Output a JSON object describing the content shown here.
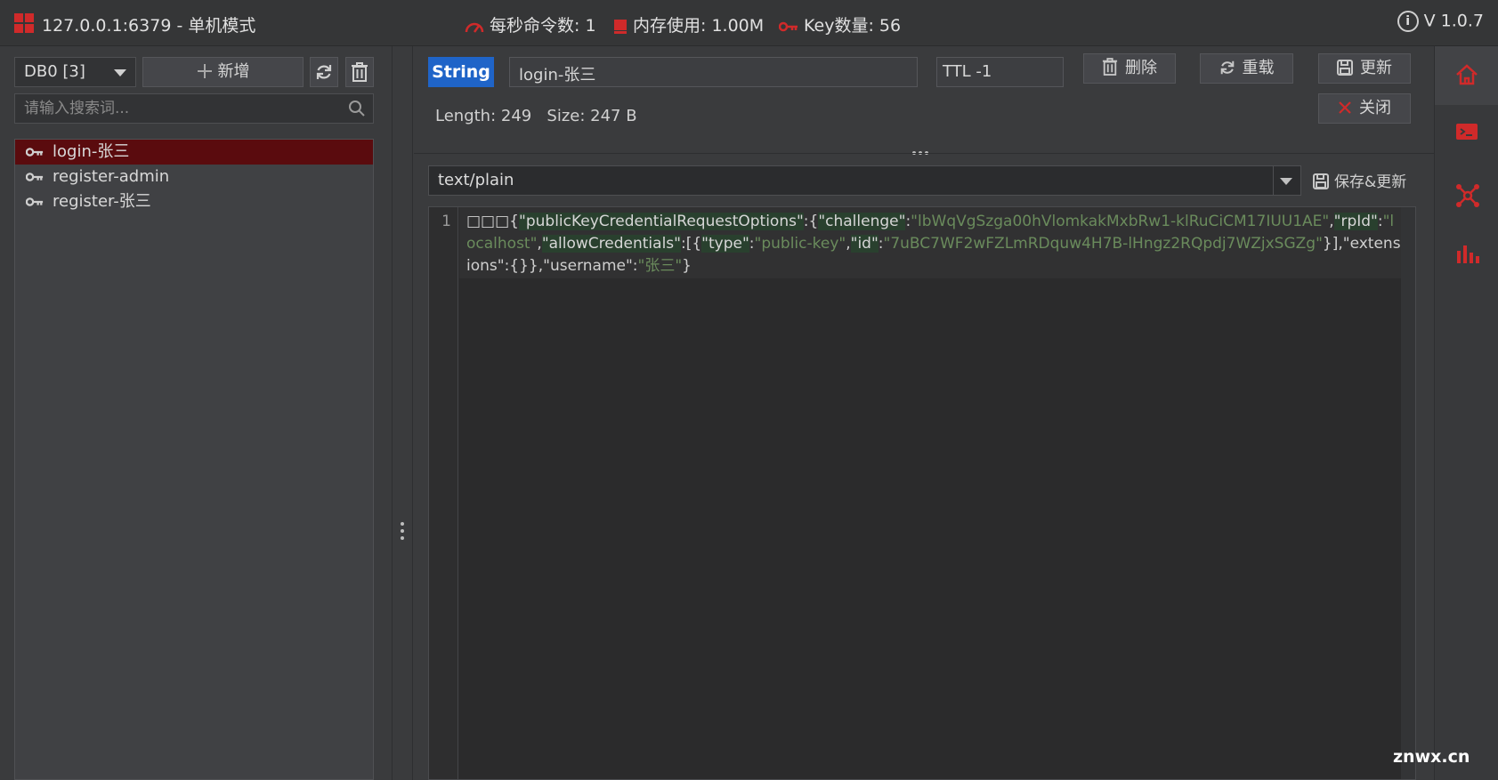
{
  "topbar": {
    "title": "127.0.0.1:6379 - 单机模式",
    "stats": {
      "ops_label": "每秒命令数: 1",
      "memory_label": "内存使用: 1.00M",
      "keys_label": "Key数量: 56"
    },
    "version": "V 1.0.7"
  },
  "left": {
    "db_select": "DB0 [3]",
    "add_label": "新增",
    "search_placeholder": "请输入搜索词...",
    "keys": [
      {
        "label": "login-张三",
        "active": true
      },
      {
        "label": "register-admin",
        "active": false
      },
      {
        "label": "register-张三",
        "active": false
      }
    ]
  },
  "main": {
    "type_badge": "String",
    "key_name": "login-张三",
    "ttl": "TTL -1",
    "actions": {
      "delete": "删除",
      "reload": "重载",
      "update": "更新",
      "close": "关闭"
    },
    "meta": "Length: 249   Size: 247 B",
    "format": "text/plain",
    "save_update": "保存&更新",
    "editor": {
      "line_number": "1",
      "prefix": "□□□{",
      "tokens": [
        {
          "t": "k",
          "s": "\"publicKeyCredentialRequestOptions\""
        },
        {
          "t": "p",
          "s": ":{"
        },
        {
          "t": "k",
          "s": "\"challenge\""
        },
        {
          "t": "p",
          "s": ":"
        },
        {
          "t": "v",
          "s": "\"lbWqVgSzga00hVlomkakMxbRw1-klRuCiCM17IUU1AE\""
        },
        {
          "t": "p",
          "s": ","
        },
        {
          "t": "k",
          "s": "\"rpId\""
        },
        {
          "t": "p",
          "s": ":"
        },
        {
          "t": "v",
          "s": "\"localhost\""
        },
        {
          "t": "p",
          "s": ","
        },
        {
          "t": "k",
          "s": "\"allowCredentials\""
        },
        {
          "t": "p",
          "s": ":[{"
        },
        {
          "t": "k",
          "s": "\"type\""
        },
        {
          "t": "p",
          "s": ":"
        },
        {
          "t": "v",
          "s": "\"public-key\""
        },
        {
          "t": "p",
          "s": ","
        },
        {
          "t": "k",
          "s": "\"id\""
        },
        {
          "t": "p",
          "s": ":"
        },
        {
          "t": "v",
          "s": "\"7uBC7WF2wFZLmRDquw4H7B-lHngz2RQpdj7WZjxSGZg\""
        },
        {
          "t": "p",
          "s": "}],"
        },
        {
          "t": "p",
          "s": "\"extensions\":{}},\"username\":"
        },
        {
          "t": "v",
          "s": "\"张三\""
        },
        {
          "t": "p",
          "s": "}"
        }
      ]
    }
  },
  "watermark": "znwx.cn",
  "colors": {
    "accent_red": "#d02a2a",
    "type_badge_blue": "#1f64c8",
    "active_key_bg": "#5a0b0e"
  },
  "icons": [
    "logo-icon",
    "speedometer-icon",
    "memory-icon",
    "key-icon",
    "info-icon",
    "plus-icon",
    "refresh-icon",
    "trash-icon",
    "search-icon",
    "save-icon",
    "close-icon",
    "home-icon",
    "terminal-icon",
    "cluster-icon",
    "chart-icon"
  ]
}
